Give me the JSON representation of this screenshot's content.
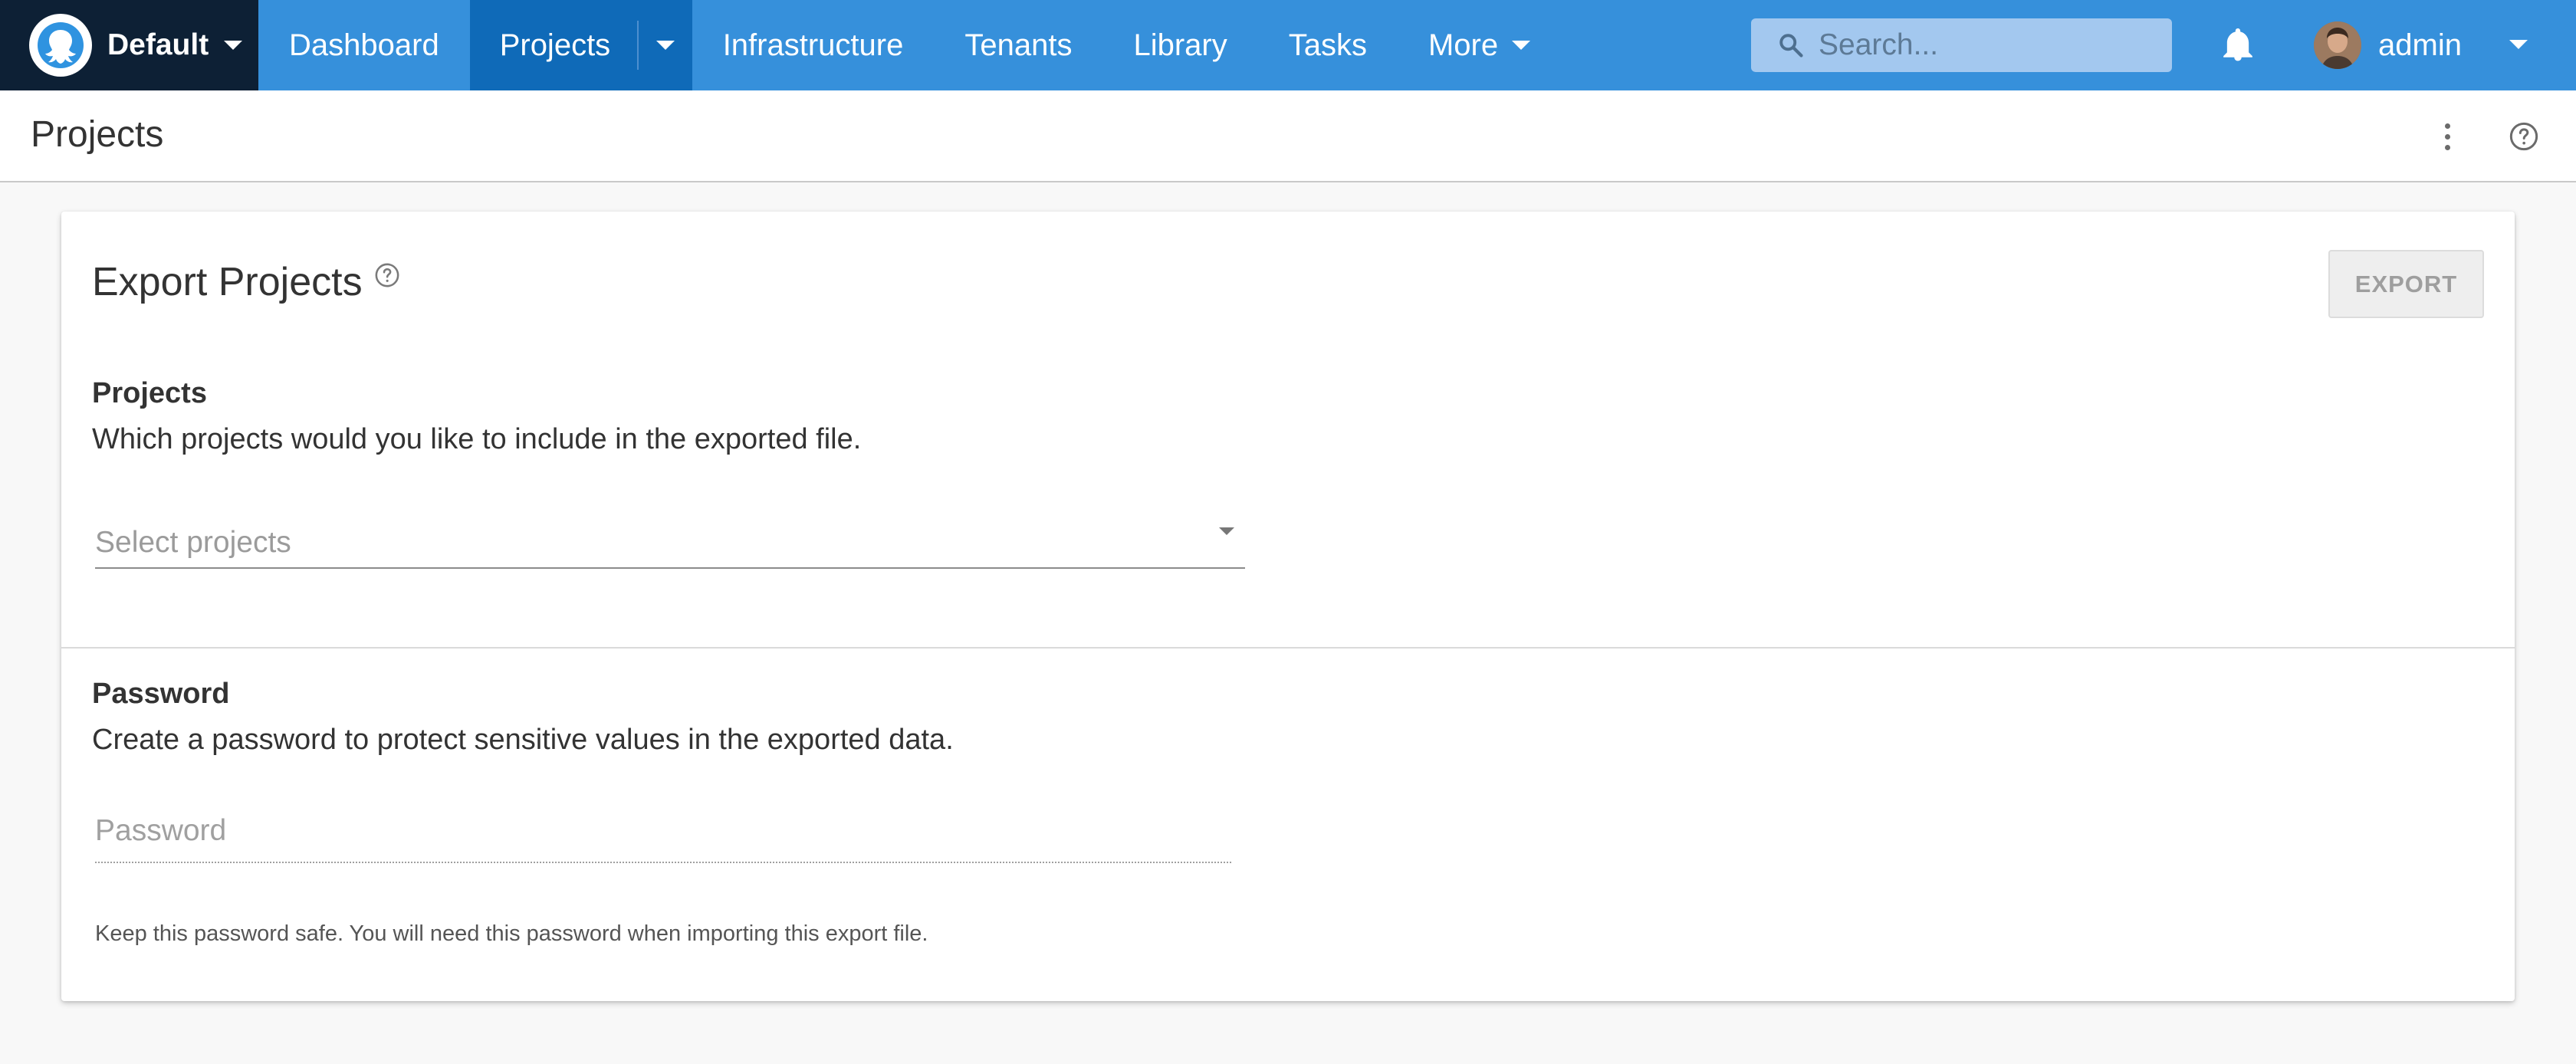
{
  "topnav": {
    "space_name": "Default",
    "items": [
      {
        "label": "Dashboard"
      },
      {
        "label": "Projects"
      },
      {
        "label": "Infrastructure"
      },
      {
        "label": "Tenants"
      },
      {
        "label": "Library"
      },
      {
        "label": "Tasks"
      },
      {
        "label": "More"
      }
    ],
    "active_item": "Projects",
    "search": {
      "placeholder": "Search..."
    },
    "user": {
      "name": "admin"
    },
    "colors": {
      "bar": "#3690db",
      "active": "#0f6ab8",
      "space_switcher": "#0d2035"
    },
    "icons": {
      "logo": "octopus-logo-icon",
      "search": "search-icon",
      "notifications": "bell-icon"
    }
  },
  "page": {
    "title": "Projects",
    "icons": {
      "overflow": "more-vertical-icon",
      "help": "help-circle-icon"
    }
  },
  "card": {
    "title": "Export Projects",
    "export_label": "EXPORT",
    "projects_section": {
      "heading": "Projects",
      "description": "Which projects would you like to include in the exported file.",
      "select_placeholder": "Select projects"
    },
    "password_section": {
      "heading": "Password",
      "description": "Create a password to protect sensitive values in the exported data.",
      "placeholder": "Password",
      "hint": "Keep this password safe. You will need this password when importing this export file."
    }
  }
}
